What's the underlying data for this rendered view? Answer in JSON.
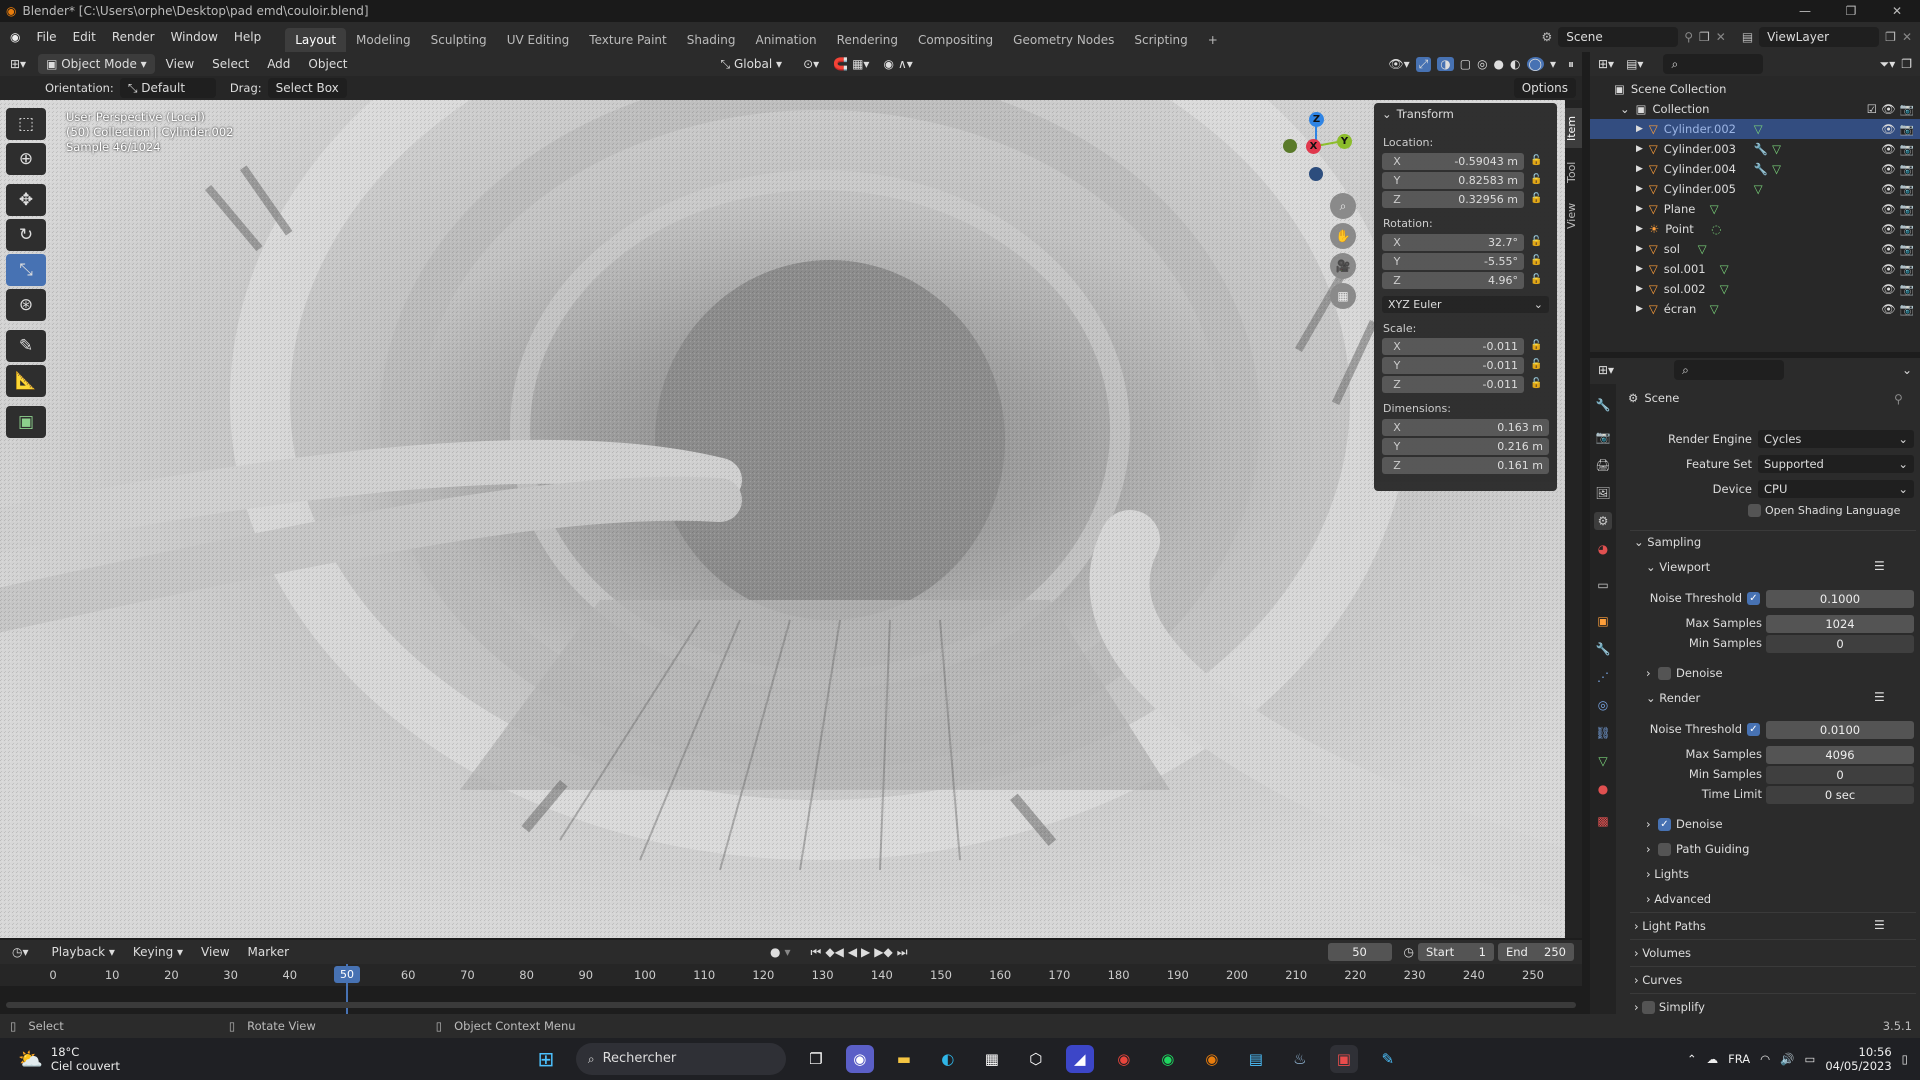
{
  "titlebar": {
    "title": "Blender* [C:\\Users\\orphe\\Desktop\\pad emd\\couloir.blend]"
  },
  "menus": [
    "File",
    "Edit",
    "Render",
    "Window",
    "Help"
  ],
  "workspaces": [
    "Layout",
    "Modeling",
    "Sculpting",
    "UV Editing",
    "Texture Paint",
    "Shading",
    "Animation",
    "Rendering",
    "Compositing",
    "Geometry Nodes",
    "Scripting",
    "+"
  ],
  "scene": {
    "label": "Scene",
    "view_layer": "ViewLayer"
  },
  "viewport_header": {
    "mode": "Object Mode",
    "menus": [
      "View",
      "Select",
      "Add",
      "Object"
    ],
    "transform_space": "Global",
    "options": "Options",
    "orientation_label": "Orientation:",
    "orientation_value": "Default",
    "drag_label": "Drag:",
    "drag_value": "Select Box"
  },
  "overlay": {
    "line1": "User Perspective (Local)",
    "line2": "(50) Collection | Cylinder.002",
    "line3": "Sample 46/1024"
  },
  "gizmo": {
    "z": "Z",
    "x": "X",
    "y": "Y"
  },
  "npanel": {
    "title": "Transform",
    "location_label": "Location:",
    "location": {
      "x": "-0.59043 m",
      "y": "0.82583 m",
      "z": "0.32956 m"
    },
    "rotation_label": "Rotation:",
    "rotation": {
      "x": "32.7°",
      "y": "-5.55°",
      "z": "4.96°"
    },
    "rotation_mode": "XYZ Euler",
    "scale_label": "Scale:",
    "scale": {
      "x": "-0.011",
      "y": "-0.011",
      "z": "-0.011"
    },
    "dimensions_label": "Dimensions:",
    "dimensions": {
      "x": "0.163 m",
      "y": "0.216 m",
      "z": "0.161 m"
    },
    "axes": {
      "x": "X",
      "y": "Y",
      "z": "Z"
    },
    "tabs": [
      "Item",
      "Tool",
      "View"
    ]
  },
  "outliner": {
    "scene_collection": "Scene Collection",
    "collection": "Collection",
    "items": [
      "Cylinder.002",
      "Cylinder.003",
      "Cylinder.004",
      "Cylinder.005",
      "Plane",
      "Point",
      "sol",
      "sol.001",
      "sol.002",
      "écran"
    ]
  },
  "properties": {
    "context": "Scene",
    "render_engine_label": "Render Engine",
    "render_engine": "Cycles",
    "feature_set_label": "Feature Set",
    "feature_set": "Supported",
    "device_label": "Device",
    "device": "CPU",
    "osl_label": "Open Shading Language",
    "sampling": "Sampling",
    "viewport": "Viewport",
    "noise_threshold_label": "Noise Threshold",
    "vp_noise_threshold": "0.1000",
    "max_samples_label": "Max Samples",
    "vp_max_samples": "1024",
    "min_samples_label": "Min Samples",
    "vp_min_samples": "0",
    "denoise_label": "Denoise",
    "render": "Render",
    "r_noise_threshold": "0.0100",
    "r_max_samples": "4096",
    "r_min_samples": "0",
    "time_limit_label": "Time Limit",
    "r_time_limit": "0 sec",
    "path_guiding": "Path Guiding",
    "lights": "Lights",
    "advanced": "Advanced",
    "light_paths": "Light Paths",
    "volumes": "Volumes",
    "curves": "Curves",
    "simplify": "Simplify"
  },
  "timeline": {
    "menus": [
      "Playback",
      "Keying",
      "View",
      "Marker"
    ],
    "current_frame": "50",
    "start_label": "Start",
    "start": "1",
    "end_label": "End",
    "end": "250",
    "ticks": [
      "0",
      "10",
      "20",
      "30",
      "40",
      "50",
      "60",
      "70",
      "80",
      "90",
      "100",
      "110",
      "120",
      "130",
      "140",
      "150",
      "160",
      "170",
      "180",
      "190",
      "200",
      "210",
      "220",
      "230",
      "240",
      "250"
    ]
  },
  "statusbar": {
    "select": "Select",
    "rotate": "Rotate View",
    "context_menu": "Object Context Menu",
    "version": "3.5.1"
  },
  "taskbar": {
    "temp": "18°C",
    "weather": "Ciel couvert",
    "search": "Rechercher",
    "lang": "FRA",
    "time": "10:56",
    "date": "04/05/2023"
  },
  "colors": {
    "accent": "#4772b3",
    "selected_row": "#334d80",
    "x_axis": "#e0384d",
    "y_axis": "#8cbd2c",
    "z_axis": "#2f84e4"
  }
}
